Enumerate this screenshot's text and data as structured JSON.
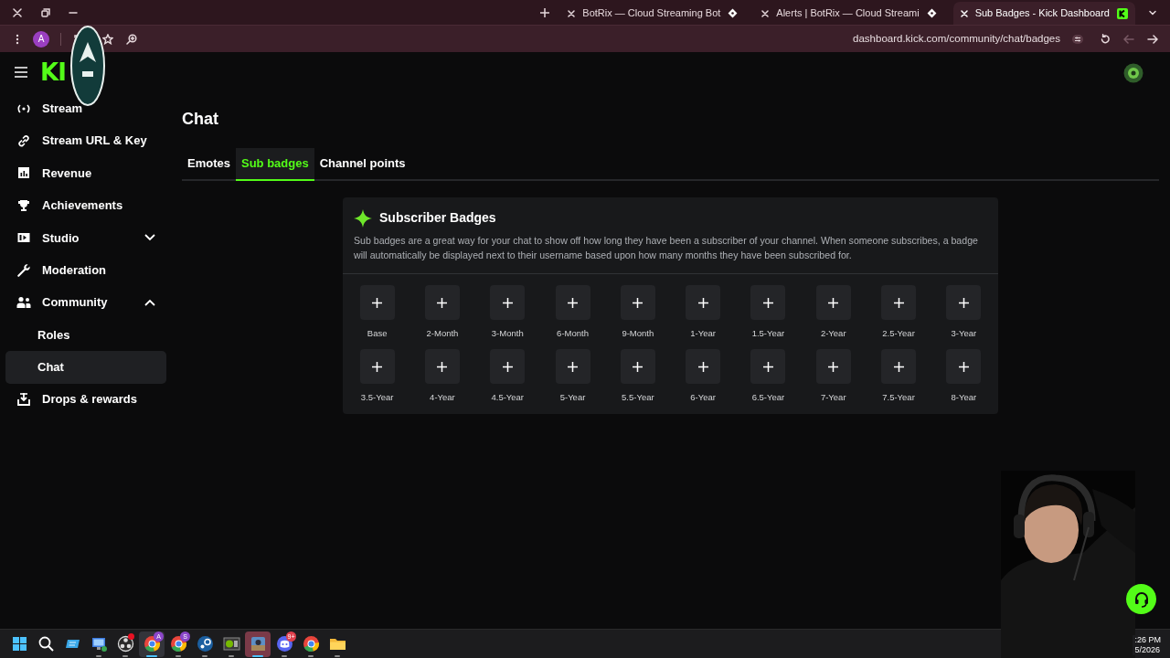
{
  "browser": {
    "tabs": [
      {
        "title": "BotRix — Cloud Streaming Bot",
        "kind": "diamond",
        "selected": false
      },
      {
        "title": "Alerts | BotRix — Cloud Streami",
        "kind": "diamond",
        "selected": false
      },
      {
        "title": "Sub Badges - Kick Dashboard",
        "kind": "kick",
        "selected": true
      }
    ],
    "profile_initial": "A",
    "address": "dashboard.kick.com/community/chat/badges"
  },
  "logo": "KI",
  "sidebar": {
    "items": [
      {
        "label": "Stream",
        "kind": "broadcast",
        "selected": false
      },
      {
        "label": "Stream URL & Key",
        "kind": "link",
        "selected": false
      },
      {
        "label": "Revenue",
        "kind": "chart",
        "selected": false
      },
      {
        "label": "Achievements",
        "kind": "trophy",
        "selected": false
      },
      {
        "label": "Studio",
        "kind": "studio",
        "selected": false,
        "expanded": false
      },
      {
        "label": "Moderation",
        "kind": "wrench",
        "selected": false
      },
      {
        "label": "Community",
        "kind": "people",
        "selected": false,
        "expanded": true,
        "children": [
          {
            "label": "Roles",
            "selected": false
          },
          {
            "label": "Chat",
            "selected": true
          }
        ]
      },
      {
        "label": "Drops & rewards",
        "kind": "drops",
        "selected": false
      }
    ]
  },
  "page": {
    "title": "Chat",
    "tabs": [
      {
        "label": "Emotes",
        "selected": false
      },
      {
        "label": "Sub badges",
        "selected": true
      },
      {
        "label": "Channel points",
        "selected": false
      }
    ]
  },
  "badges_card": {
    "title": "Subscriber Badges",
    "description": "Sub badges are a great way for your chat to show off how long they have been a subscriber of your channel. When someone subscribes, a badge will automatically be displayed next to their username based upon how many months they have been subscribed for.",
    "badges": [
      "Base",
      "2-Month",
      "3-Month",
      "6-Month",
      "9-Month",
      "1-Year",
      "1.5-Year",
      "2-Year",
      "2.5-Year",
      "3-Year",
      "3.5-Year",
      "4-Year",
      "4.5-Year",
      "5-Year",
      "5.5-Year",
      "6-Year",
      "6.5-Year",
      "7-Year",
      "7.5-Year",
      "8-Year"
    ]
  },
  "taskbar": {
    "apps": [
      {
        "kind": "start",
        "selected": false
      },
      {
        "kind": "search",
        "selected": false
      },
      {
        "kind": "widget",
        "selected": false
      },
      {
        "kind": "remote",
        "running": true,
        "selected": false
      },
      {
        "kind": "obs",
        "running": true,
        "selected": false,
        "alert": true
      },
      {
        "kind": "browser",
        "running": true,
        "selected": true,
        "badge": "A"
      },
      {
        "kind": "browser",
        "running": true,
        "selected": false,
        "badge": "S"
      },
      {
        "kind": "steam",
        "running": true,
        "selected": false
      },
      {
        "kind": "gpu",
        "running": true,
        "selected": false
      },
      {
        "kind": "game",
        "running": true,
        "selected": true
      },
      {
        "kind": "discord",
        "running": true,
        "selected": false,
        "badge": "9+"
      },
      {
        "kind": "browser",
        "running": true,
        "selected": false
      },
      {
        "kind": "folder",
        "running": true,
        "selected": false
      }
    ],
    "clock": {
      "time": ":26 PM",
      "date": "5/2026"
    }
  }
}
